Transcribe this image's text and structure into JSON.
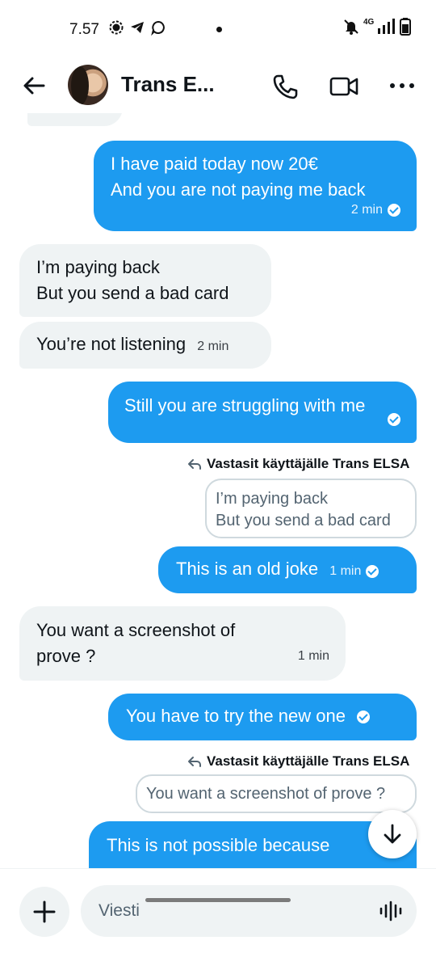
{
  "status_bar": {
    "time": "7.57",
    "network": "4G"
  },
  "header": {
    "contact_name": "Trans E...",
    "back_icon": "arrow-left-icon",
    "call_icon": "phone-icon",
    "video_icon": "video-camera-icon",
    "more_icon": "more-horizontal-icon"
  },
  "messages": [
    {
      "id": "m1",
      "direction": "out",
      "lines": [
        "I have paid today now 20€",
        "And you are not paying me back"
      ],
      "time": "2 min",
      "read": true
    },
    {
      "id": "m2",
      "direction": "in",
      "lines": [
        "I’m paying back",
        "But you send a bad card"
      ]
    },
    {
      "id": "m3",
      "direction": "in",
      "lines": [
        "You’re not listening"
      ],
      "time": "2 min"
    },
    {
      "id": "m4",
      "direction": "out",
      "lines": [
        "Still you are struggling with me"
      ],
      "read": true
    },
    {
      "id": "m5",
      "direction": "out",
      "reply_label": "Vastasit käyttäjälle Trans ELSA",
      "quote_lines": [
        "I’m paying back",
        "But you send a bad card"
      ],
      "lines": [
        "This is an old joke"
      ],
      "time": "1 min",
      "read": true
    },
    {
      "id": "m6",
      "direction": "in",
      "lines": [
        "You want a screenshot of",
        "prove ?"
      ],
      "time": "1 min"
    },
    {
      "id": "m7",
      "direction": "out",
      "lines": [
        "You have to try the new one"
      ],
      "read": true
    },
    {
      "id": "m8",
      "direction": "out",
      "reply_label": "Vastasit käyttäjälle Trans ELSA",
      "quote_lines": [
        "You want a screenshot of prove ?"
      ],
      "lines": [
        "This is not possible because"
      ]
    }
  ],
  "composer": {
    "placeholder": "Viesti",
    "add_icon": "plus-icon",
    "voice_icon": "voice-wave-icon",
    "scroll_icon": "arrow-down-icon"
  },
  "colors": {
    "outgoing_bubble": "#1d9bf0",
    "incoming_bubble": "#eff3f4",
    "text": "#0f1419"
  }
}
